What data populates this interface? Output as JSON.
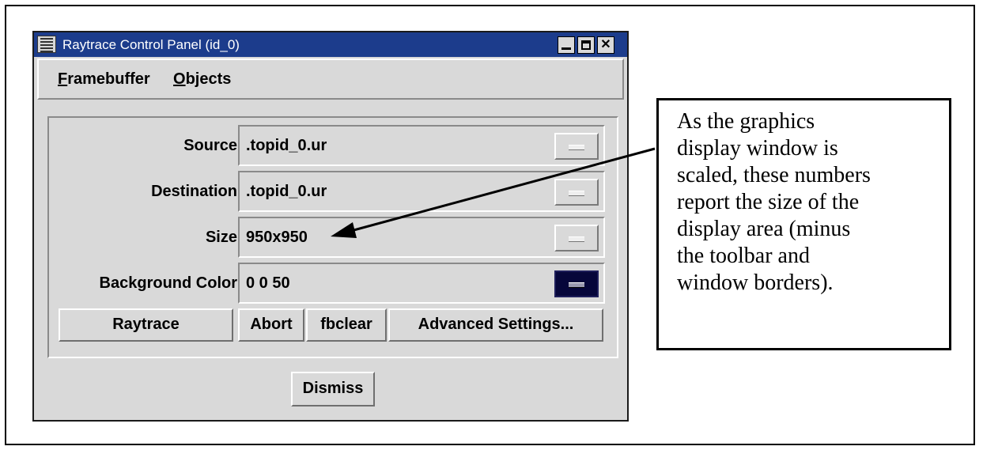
{
  "window": {
    "title": "Raytrace Control Panel (id_0)",
    "menus": [
      {
        "mnemonic": "F",
        "rest": "ramebuffer"
      },
      {
        "mnemonic": "O",
        "rest": "bjects"
      }
    ],
    "fields": [
      {
        "label": "Source",
        "value": ".topid_0.ur",
        "button_style": "normal"
      },
      {
        "label": "Destination",
        "value": ".topid_0.ur",
        "button_style": "normal"
      },
      {
        "label": "Size",
        "value": "950x950",
        "button_style": "normal"
      },
      {
        "label": "Background Color",
        "value": "0 0 50",
        "button_style": "color",
        "swatch_color": "#06063a"
      }
    ],
    "buttons": {
      "raytrace": "Raytrace",
      "abort": "Abort",
      "fbclear": "fbclear",
      "advanced": "Advanced Settings...",
      "dismiss": "Dismiss"
    },
    "title_bar_color": "#1c3c8c"
  },
  "callout": {
    "lines": [
      "As the graphics",
      "display window is",
      "scaled, these numbers",
      "report the size of the",
      "display area (minus",
      "the toolbar and",
      "window borders)."
    ]
  }
}
